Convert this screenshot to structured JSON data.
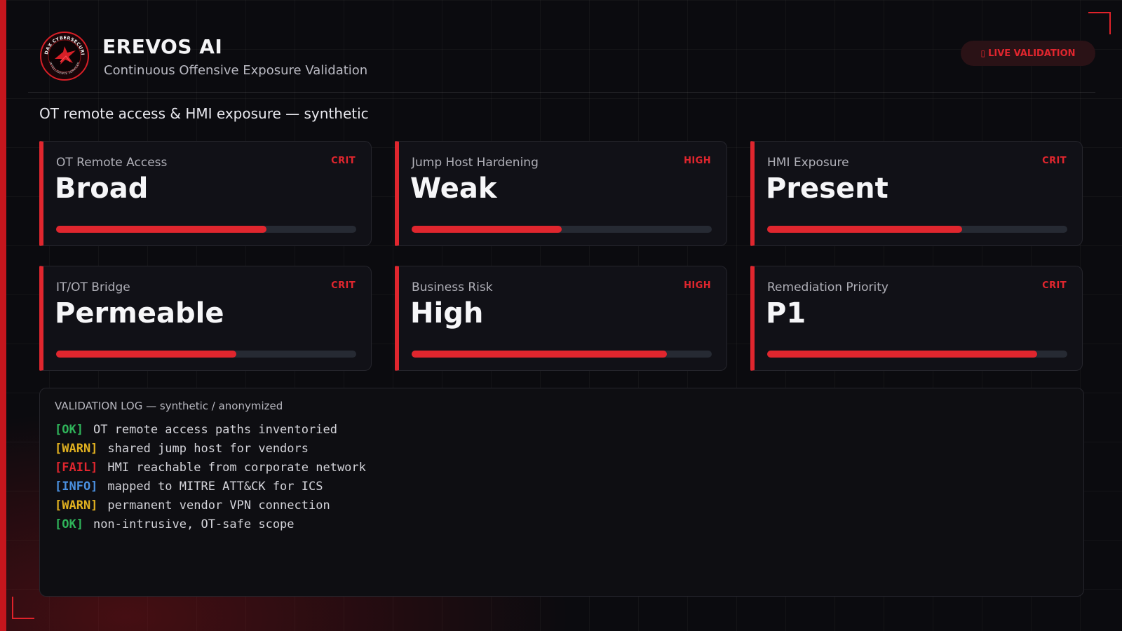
{
  "header": {
    "logo_text": "AUDAX CYBERSECURITY · INTELLIGENCE SERVICES",
    "title": "EREVOS AI",
    "subtitle": "Continuous Offensive Exposure Validation",
    "live_badge": "LIVE VALIDATION",
    "live_dot": "▯"
  },
  "section_title": "OT remote access & HMI exposure — synthetic",
  "cards": [
    {
      "label": "OT Remote Access",
      "severity": "CRIT",
      "value": "Broad",
      "level": 0.7
    },
    {
      "label": "Jump Host Hardening",
      "severity": "HIGH",
      "value": "Weak",
      "level": 0.5
    },
    {
      "label": "HMI Exposure",
      "severity": "CRIT",
      "value": "Present",
      "level": 0.65
    },
    {
      "label": "IT/OT Bridge",
      "severity": "CRIT",
      "value": "Permeable",
      "level": 0.6
    },
    {
      "label": "Business Risk",
      "severity": "HIGH",
      "value": "High",
      "level": 0.85
    },
    {
      "label": "Remediation Priority",
      "severity": "CRIT",
      "value": "P1",
      "level": 0.9
    }
  ],
  "log": {
    "title": "VALIDATION LOG — synthetic / anonymized",
    "lines": [
      {
        "tag": "[OK]",
        "text": "OT remote access paths inventoried"
      },
      {
        "tag": "[WARN]",
        "text": "shared jump host for vendors"
      },
      {
        "tag": "[FAIL]",
        "text": "HMI reachable from corporate network"
      },
      {
        "tag": "[INFO]",
        "text": "mapped to MITRE ATT&CK for ICS"
      },
      {
        "tag": "[WARN]",
        "text": "permanent vendor VPN connection"
      },
      {
        "tag": "[OK]",
        "text": "non-intrusive, OT-safe scope"
      }
    ]
  },
  "colors": {
    "accent": "#e0262e",
    "ok": "#2fb45a",
    "warn": "#e0b020",
    "info": "#4a90e0"
  }
}
